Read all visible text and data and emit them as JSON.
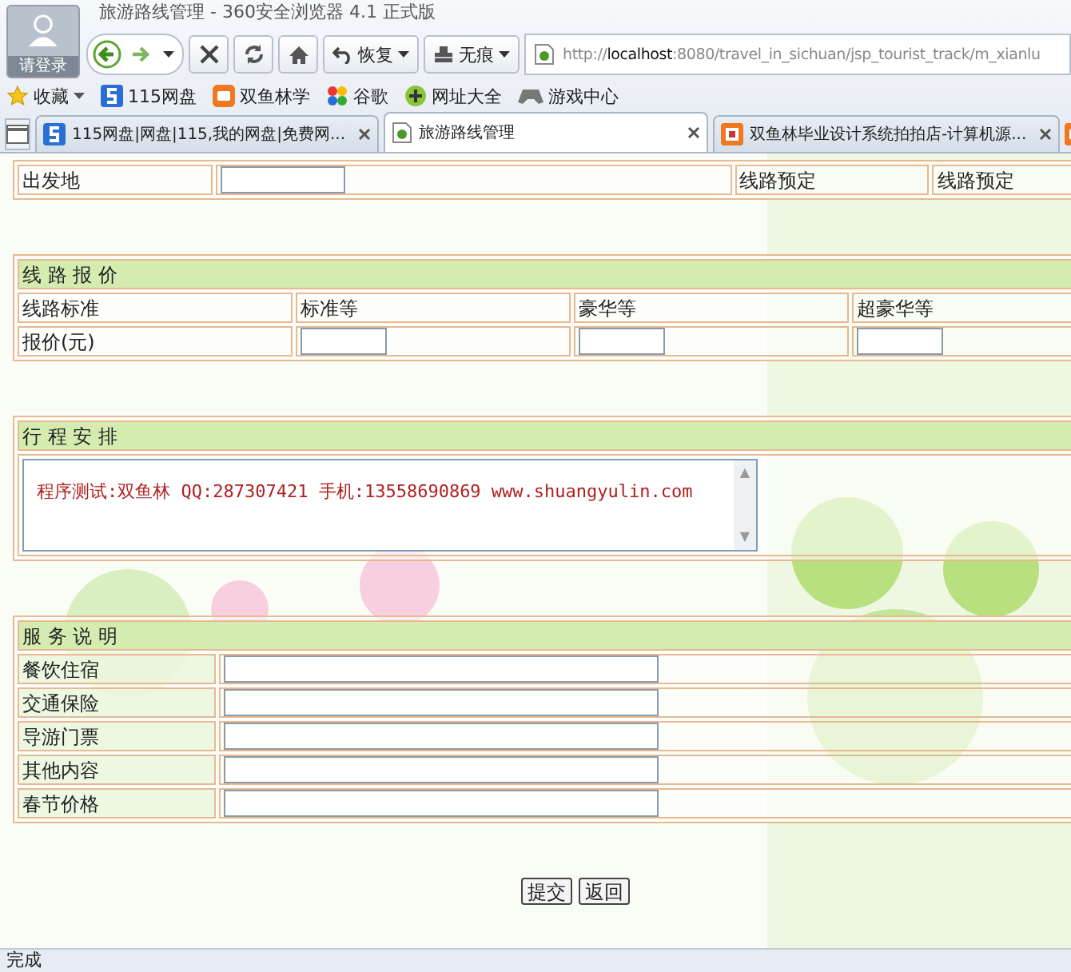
{
  "browser": {
    "title": "旅游路线管理 - 360安全浏览器 4.1 正式版",
    "avatar_label": "请登录",
    "toolbar": [
      {
        "kind": "restore",
        "label": "恢复"
      },
      {
        "kind": "private",
        "label": "无痕"
      }
    ],
    "address": {
      "scheme": "http://",
      "host": "localhost",
      "rest": ":8080/travel_in_sichuan/jsp_tourist_track/m_xianlu"
    },
    "bookmarks": [
      {
        "kind": "star",
        "label": "收藏"
      },
      {
        "kind": "s",
        "label": "115网盘"
      },
      {
        "kind": "tao",
        "label": "双鱼林学"
      },
      {
        "kind": "google",
        "label": "谷歌"
      },
      {
        "kind": "plus",
        "label": "网址大全"
      },
      {
        "kind": "game",
        "label": "游戏中心"
      }
    ],
    "tabs": [
      {
        "kind": "s",
        "title": "115网盘|网盘|115,我的网盘|免费网...",
        "selected": false
      },
      {
        "kind": "page",
        "title": "旅游路线管理",
        "selected": true
      },
      {
        "kind": "pai",
        "title": "双鱼林毕业设计系统拍拍店-计算机源...",
        "selected": false
      }
    ]
  },
  "form": {
    "departure": {
      "label": "出发地",
      "booking": [
        "线路预定",
        "线路预定"
      ]
    },
    "pricing": {
      "title": "线 路 报 价",
      "header": [
        "线路标准",
        "标准等",
        "豪华等",
        "超豪华等"
      ],
      "row_label": "报价(元)"
    },
    "itinerary": {
      "title": "行 程 安 排",
      "text": "程序测试:双鱼林 QQ:287307421 手机:13558690869 www.shuangyulin.com",
      "scroll_arrows": [
        "▲",
        "▼"
      ]
    },
    "services": {
      "title": "服 务 说 明",
      "rows": [
        "餐饮住宿",
        "交通保险",
        "导游门票",
        "其他内容",
        "春节价格"
      ]
    },
    "buttons": [
      "提交",
      "返回"
    ]
  },
  "status_bar": "完成"
}
